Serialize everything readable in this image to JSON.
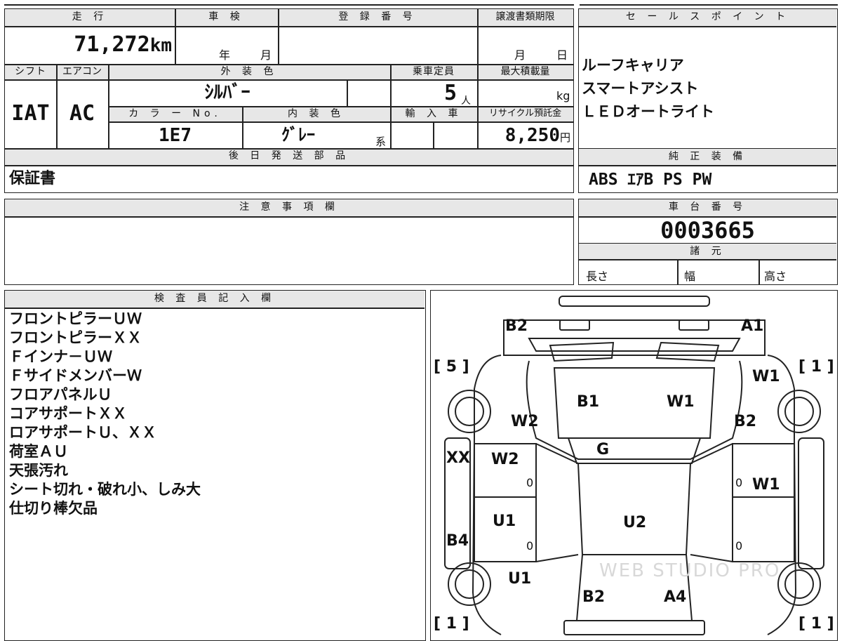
{
  "top": {
    "mileage_label": "走 行",
    "mileage_value": "71,272",
    "mileage_unit": "km",
    "inspection_label": "車 検",
    "year_unit": "年",
    "month_unit": "月",
    "registration_label": "登 録 番 号",
    "transfer_label": "譲渡書類期限",
    "transfer_month": "月",
    "transfer_day": "日"
  },
  "specs": {
    "shift_label": "シフト",
    "shift_value": "IAT",
    "aircon_label": "エアコン",
    "aircon_value": "AC",
    "exterior_label": "外 装 色",
    "exterior_value": "ｼﾙﾊﾞｰ",
    "color_no_label": "カ ラ ー No.",
    "color_no_value": "1E7",
    "interior_label": "内 装 色",
    "interior_value": "ｸﾞﾚｰ",
    "interior_suffix": "系",
    "capacity_label": "乗車定員",
    "capacity_value": "5",
    "capacity_unit": "人",
    "import_label": "輸 入 車",
    "max_load_label": "最大積載量",
    "max_load_unit": "kg",
    "recycle_label": "リサイクル預託金",
    "recycle_value": "8,250",
    "recycle_unit": "円"
  },
  "later_parts": {
    "label": "後 日 発 送 部 品",
    "value": "保証書"
  },
  "sales_points": {
    "label": "セ ー ル ス ポ イ ン ト",
    "items": [
      "ルーフキャリア",
      "スマートアシスト",
      "ＬＥＤオートライト"
    ]
  },
  "genuine_equipment": {
    "label": "純 正 装 備",
    "value": "ABS ｴｱB PS PW"
  },
  "notes": {
    "label": "注 意 事 項 欄"
  },
  "chassis": {
    "label": "車 台 番 号",
    "value": "0003665"
  },
  "dimensions": {
    "label": "諸 元",
    "length": "長さ",
    "width": "幅",
    "height": "高さ"
  },
  "inspector": {
    "label": "検 査 員 記 入 欄",
    "lines": [
      "フロントピラーＵＷ",
      "フロントピラーＸＸ",
      "Ｆインナ－ＵＷ",
      "ＦサイドメンバーＷ",
      "フロアパネルＵ",
      "コアサポートＸＸ",
      "ロアサポートＵ、ＸＸ",
      "荷室ＡＵ",
      "天張汚れ",
      "シート切れ・破れ小、しみ大",
      "仕切り棒欠品"
    ]
  },
  "diagram": {
    "front_left": "B2",
    "front_right": "A1",
    "tire_fl": "[ 5 ]",
    "tire_fr": "[ 1 ]",
    "tire_rl": "[ 1 ]",
    "tire_rr": "[ 1 ]",
    "hood_left": "B1",
    "hood_right": "W1",
    "fender_left": "W2",
    "fender_right_top": "W1",
    "fender_right": "B2",
    "windshield": "G",
    "left_sill": "XX",
    "front_door_left": "W2",
    "front_door_right": "W1",
    "rear_door_left": "U1",
    "roof": "U2",
    "left_rear_side": "B4",
    "rear_quarter_left": "U1",
    "rear_left": "B2",
    "rear_right": "A4",
    "zero": "0",
    "watermark": "WEB STUDIO PRO"
  }
}
